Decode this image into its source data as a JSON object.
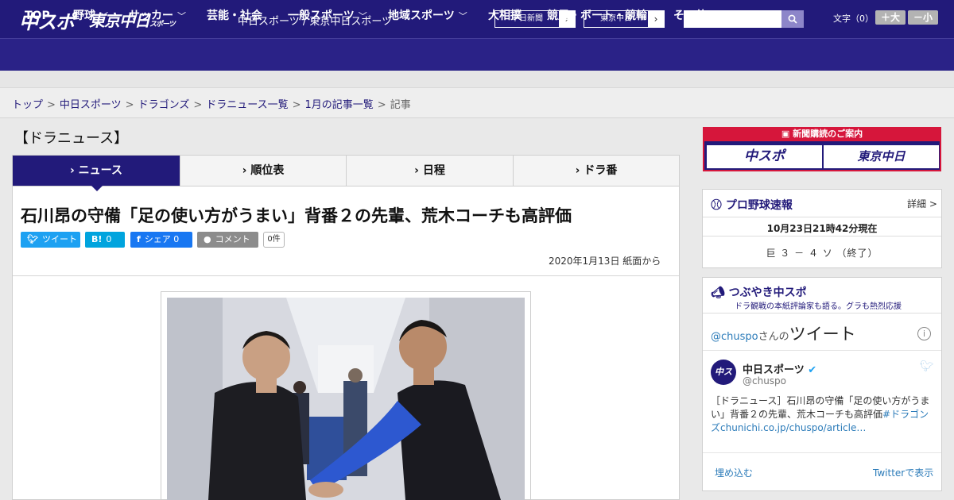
{
  "header": {
    "logo_main": "中スポ",
    "logo_tokyo": "東京中日",
    "logo_tokyo_sub": "スポーツ",
    "site_title": "中日スポーツ / 東京中日スポーツ",
    "papers": [
      "中日新聞",
      "東京中日"
    ],
    "search_placeholder": "",
    "font_size_label": "文字（0）",
    "font_larger": "＋大",
    "font_smaller": "－小"
  },
  "nav": [
    {
      "label": "TOP",
      "dropdown": false
    },
    {
      "label": "野球",
      "dropdown": true
    },
    {
      "label": "サッカー",
      "dropdown": true
    },
    {
      "label": "芸能・社会",
      "dropdown": false
    },
    {
      "label": "一般スポーツ",
      "dropdown": true
    },
    {
      "label": "地域スポーツ",
      "dropdown": true
    },
    {
      "label": "大相撲",
      "dropdown": false
    },
    {
      "label": "競馬・ボート・競輪",
      "dropdown": false
    },
    {
      "label": "その他",
      "dropdown": true
    }
  ],
  "breadcrumb": {
    "links": [
      "トップ",
      "中日スポーツ",
      "ドラゴンズ",
      "ドラニュース一覧",
      "1月の記事一覧"
    ],
    "current": "記事"
  },
  "section_title": "【ドラニュース】",
  "tabs": [
    {
      "label": "ニュース",
      "active": true
    },
    {
      "label": "順位表",
      "active": false
    },
    {
      "label": "日程",
      "active": false
    },
    {
      "label": "ドラ番",
      "active": false
    }
  ],
  "article": {
    "headline": "石川昂の守備「足の使い方がうまい」背番２の先輩、荒木コーチも高評価",
    "date": "2020年1月13日 紙面から"
  },
  "share": {
    "tweet": "ツイート",
    "hatena_icon": "B!",
    "hatena_count": "0",
    "facebook": "シェア 0",
    "comment": "コメント",
    "comment_count": "0件"
  },
  "sidebar": {
    "promo_title": "新聞購読のご案内",
    "promo_left": "中スポ",
    "promo_right": "東京中日",
    "score_title": "プロ野球速報",
    "score_more": "詳細 >",
    "score_time": "10月23日21時42分現在",
    "score_line": "巨 ３ － ４ ソ （終了）",
    "tw_title": "つぶやき中スポ",
    "tw_subtitle": "ドラ観戦の本紙評論家も語る。グラも熱烈応援",
    "tw_user_link": "@chuspo",
    "tw_user_suffix": "さんの",
    "tw_word": "ツイート",
    "tw_avatar": "中スポ",
    "tw_name": "中日スポーツ",
    "tw_handle": "@chuspo",
    "tw_text": "［ドラニュース］石川昂の守備「足の使い方がうまい」背番２の先輩、荒木コーチも高評価",
    "tw_tag": "#ドラゴンズ",
    "tw_link": "chunichi.co.jp/chuspo/article…",
    "tw_embed": "埋め込む",
    "tw_view": "Twitterで表示"
  },
  "colors": {
    "brand_navy": "#221a7a",
    "nav_navy": "#2a2287",
    "twitter": "#1da1f2",
    "hatena": "#00a4de",
    "facebook": "#1877f2",
    "promo_red": "#d6163b"
  }
}
